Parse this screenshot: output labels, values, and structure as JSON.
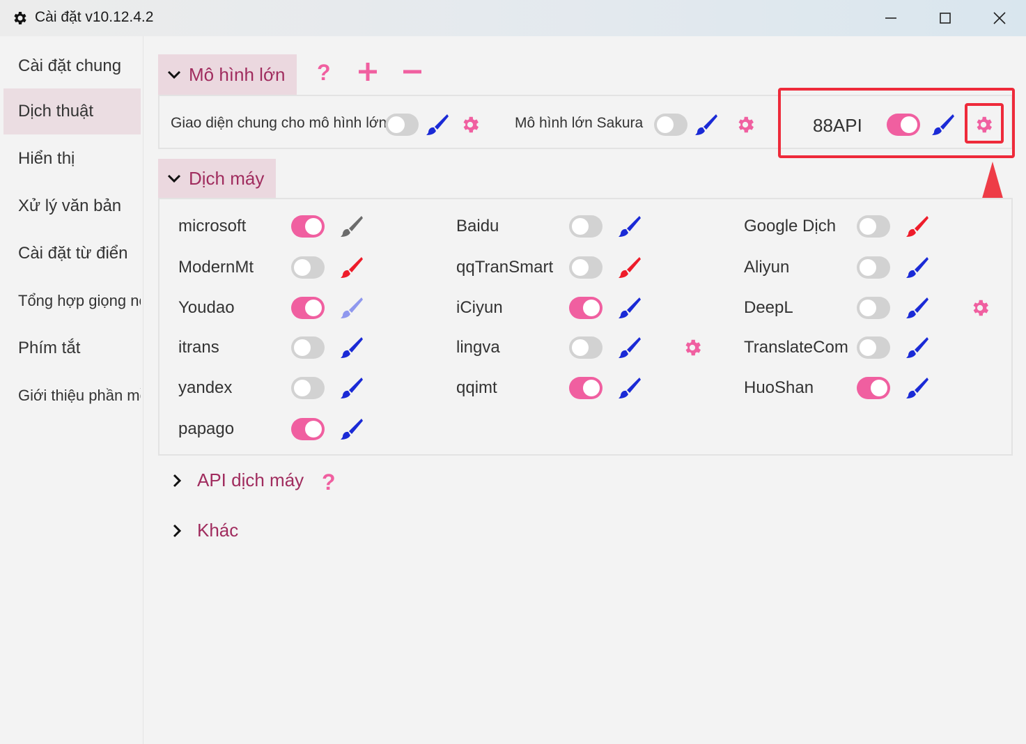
{
  "window": {
    "title": "Cài đặt v10.12.4.2"
  },
  "sidebar": {
    "items": [
      {
        "label": "Cài đặt chung"
      },
      {
        "label": "Dịch thuật"
      },
      {
        "label": "Hiển thị"
      },
      {
        "label": "Xử lý văn bản"
      },
      {
        "label": "Cài đặt từ điển"
      },
      {
        "label": "Tổng hợp giọng nói"
      },
      {
        "label": "Phím tắt"
      },
      {
        "label": "Giới thiệu phần mềm"
      }
    ],
    "active_index": 1
  },
  "llm_section": {
    "title": "Mô hình lớn",
    "help_label": "?",
    "items": [
      {
        "label": "Giao diện chung cho mô hình lớn",
        "enabled": false,
        "brush_color": "#1a2ad6",
        "has_settings": true
      },
      {
        "label": "Mô hình lớn Sakura",
        "enabled": false,
        "brush_color": "#1a2ad6",
        "has_settings": true
      },
      {
        "label": "88API",
        "enabled": true,
        "brush_color": "#1a2ad6",
        "has_settings": true
      }
    ]
  },
  "mt_section": {
    "title": "Dịch máy",
    "items": [
      {
        "label": "microsoft",
        "enabled": true,
        "brush_color": "#6b6b6b",
        "has_settings": false
      },
      {
        "label": "Baidu",
        "enabled": false,
        "brush_color": "#1a2ad6",
        "has_settings": false
      },
      {
        "label": "Google Dịch",
        "enabled": false,
        "brush_color": "#ee1c2a",
        "has_settings": false
      },
      {
        "label": "ModernMt",
        "enabled": false,
        "brush_color": "#ee1c2a",
        "has_settings": false
      },
      {
        "label": "qqTranSmart",
        "enabled": false,
        "brush_color": "#ee1c2a",
        "has_settings": false
      },
      {
        "label": "Aliyun",
        "enabled": false,
        "brush_color": "#1a2ad6",
        "has_settings": false
      },
      {
        "label": "Youdao",
        "enabled": true,
        "brush_color": "#8f98ee",
        "has_settings": false
      },
      {
        "label": "iCiyun",
        "enabled": true,
        "brush_color": "#1a2ad6",
        "has_settings": false
      },
      {
        "label": "DeepL",
        "enabled": false,
        "brush_color": "#1a2ad6",
        "has_settings": true
      },
      {
        "label": "itrans",
        "enabled": false,
        "brush_color": "#1a2ad6",
        "has_settings": false
      },
      {
        "label": "lingva",
        "enabled": false,
        "brush_color": "#1a2ad6",
        "has_settings": true
      },
      {
        "label": "TranslateCom",
        "enabled": false,
        "brush_color": "#1a2ad6",
        "has_settings": false
      },
      {
        "label": "yandex",
        "enabled": false,
        "brush_color": "#1a2ad6",
        "has_settings": false
      },
      {
        "label": "qqimt",
        "enabled": true,
        "brush_color": "#1a2ad6",
        "has_settings": false
      },
      {
        "label": "HuoShan",
        "enabled": true,
        "brush_color": "#1a2ad6",
        "has_settings": false
      },
      {
        "label": "papago",
        "enabled": true,
        "brush_color": "#1a2ad6",
        "has_settings": false
      }
    ]
  },
  "collapsed_sections": [
    {
      "title": "API dịch máy",
      "help_label": "?"
    },
    {
      "title": "Khác"
    }
  ],
  "colors": {
    "accent_pink": "#f05fa0",
    "section_text": "#a02c5e",
    "highlight_red": "#ee2a3a"
  }
}
